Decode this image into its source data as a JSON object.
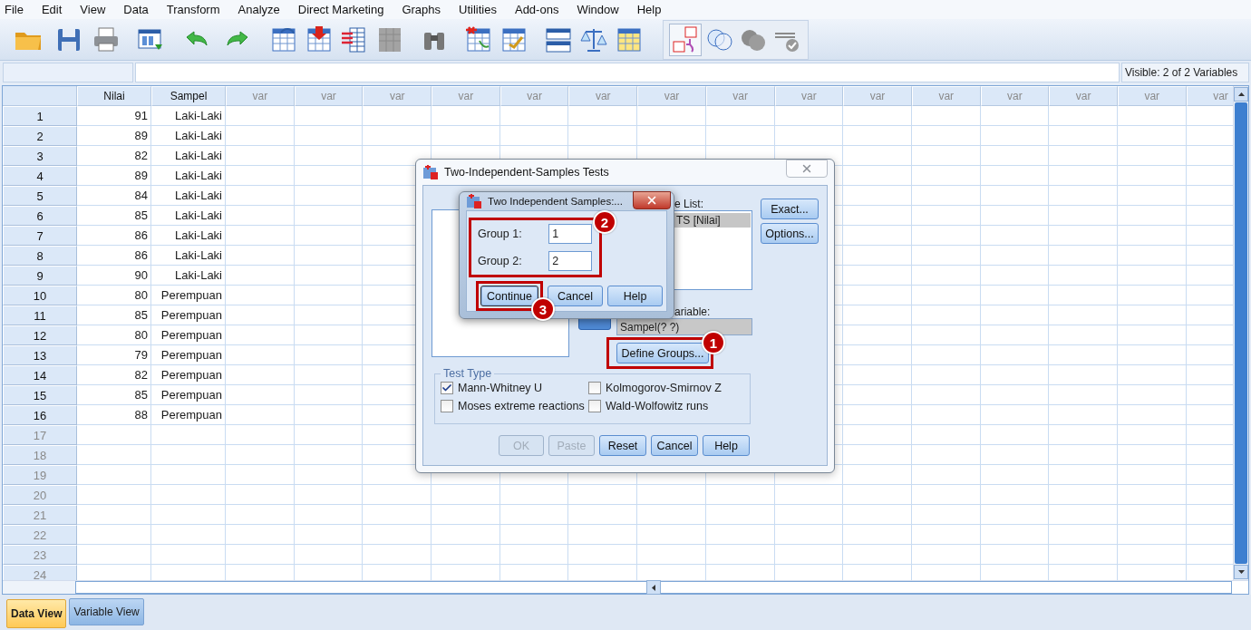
{
  "menu": [
    "File",
    "Edit",
    "View",
    "Data",
    "Transform",
    "Analyze",
    "Direct Marketing",
    "Graphs",
    "Utilities",
    "Add-ons",
    "Window",
    "Help"
  ],
  "cell_editor": {
    "status": "Visible: 2 of 2 Variables"
  },
  "grid": {
    "columns": [
      {
        "label": "Nilai",
        "defined": true
      },
      {
        "label": "Sampel",
        "defined": true
      },
      {
        "label": "var",
        "defined": false
      },
      {
        "label": "var",
        "defined": false
      },
      {
        "label": "var",
        "defined": false
      },
      {
        "label": "var",
        "defined": false
      },
      {
        "label": "var",
        "defined": false
      },
      {
        "label": "var",
        "defined": false
      },
      {
        "label": "var",
        "defined": false
      },
      {
        "label": "var",
        "defined": false
      },
      {
        "label": "var",
        "defined": false
      },
      {
        "label": "var",
        "defined": false
      },
      {
        "label": "var",
        "defined": false
      },
      {
        "label": "var",
        "defined": false
      },
      {
        "label": "var",
        "defined": false
      },
      {
        "label": "var",
        "defined": false
      },
      {
        "label": "var",
        "defined": false
      }
    ],
    "rows": [
      {
        "number": "1",
        "cells": [
          "91",
          "Laki-Laki"
        ]
      },
      {
        "number": "2",
        "cells": [
          "89",
          "Laki-Laki"
        ]
      },
      {
        "number": "3",
        "cells": [
          "82",
          "Laki-Laki"
        ]
      },
      {
        "number": "4",
        "cells": [
          "89",
          "Laki-Laki"
        ]
      },
      {
        "number": "5",
        "cells": [
          "84",
          "Laki-Laki"
        ]
      },
      {
        "number": "6",
        "cells": [
          "85",
          "Laki-Laki"
        ]
      },
      {
        "number": "7",
        "cells": [
          "86",
          "Laki-Laki"
        ]
      },
      {
        "number": "8",
        "cells": [
          "86",
          "Laki-Laki"
        ]
      },
      {
        "number": "9",
        "cells": [
          "90",
          "Laki-Laki"
        ]
      },
      {
        "number": "10",
        "cells": [
          "80",
          "Perempuan"
        ]
      },
      {
        "number": "11",
        "cells": [
          "85",
          "Perempuan"
        ]
      },
      {
        "number": "12",
        "cells": [
          "80",
          "Perempuan"
        ]
      },
      {
        "number": "13",
        "cells": [
          "79",
          "Perempuan"
        ]
      },
      {
        "number": "14",
        "cells": [
          "82",
          "Perempuan"
        ]
      },
      {
        "number": "15",
        "cells": [
          "85",
          "Perempuan"
        ]
      },
      {
        "number": "16",
        "cells": [
          "88",
          "Perempuan"
        ]
      },
      {
        "number": "17",
        "cells": []
      },
      {
        "number": "18",
        "cells": []
      },
      {
        "number": "19",
        "cells": []
      },
      {
        "number": "20",
        "cells": []
      },
      {
        "number": "21",
        "cells": []
      },
      {
        "number": "22",
        "cells": []
      },
      {
        "number": "23",
        "cells": []
      },
      {
        "number": "24",
        "cells": []
      }
    ]
  },
  "view_tabs": [
    {
      "label": "Data View",
      "selected": true
    },
    {
      "label": "Variable View",
      "selected": false
    }
  ],
  "dialog": {
    "title": "Two-Independent-Samples Tests",
    "test_variable_label": "e List:",
    "test_variables": [
      {
        "label": "TS [Nilai]",
        "selected": true
      }
    ],
    "grouping_label": "ariable:",
    "grouping_value": "Sampel(? ?)",
    "define_groups": {
      "label": "Define Groups...",
      "callout": "1"
    },
    "side_buttons": [
      "Exact...",
      "Options..."
    ],
    "test_type": {
      "title": "Test Type",
      "options": [
        {
          "label": "Mann-Whitney U",
          "checked": true
        },
        {
          "label": "Kolmogorov-Smirnov Z",
          "checked": false
        },
        {
          "label": "Moses extreme reactions",
          "checked": false
        },
        {
          "label": "Wald-Wolfowitz runs",
          "checked": false
        }
      ]
    },
    "buttons": [
      {
        "label": "OK",
        "disabled": true
      },
      {
        "label": "Paste",
        "disabled": true
      },
      {
        "label": "Reset",
        "disabled": false
      },
      {
        "label": "Cancel",
        "disabled": false
      },
      {
        "label": "Help",
        "disabled": false
      }
    ]
  },
  "subdialog": {
    "title": "Two Independent Samples:...",
    "callout": "2",
    "groups": [
      {
        "label": "Group 1:",
        "value": "1"
      },
      {
        "label": "Group 2:",
        "value": "2"
      }
    ],
    "buttons": [
      {
        "label": "Continue",
        "callout": "3"
      },
      {
        "label": "Cancel"
      },
      {
        "label": "Help"
      }
    ]
  }
}
